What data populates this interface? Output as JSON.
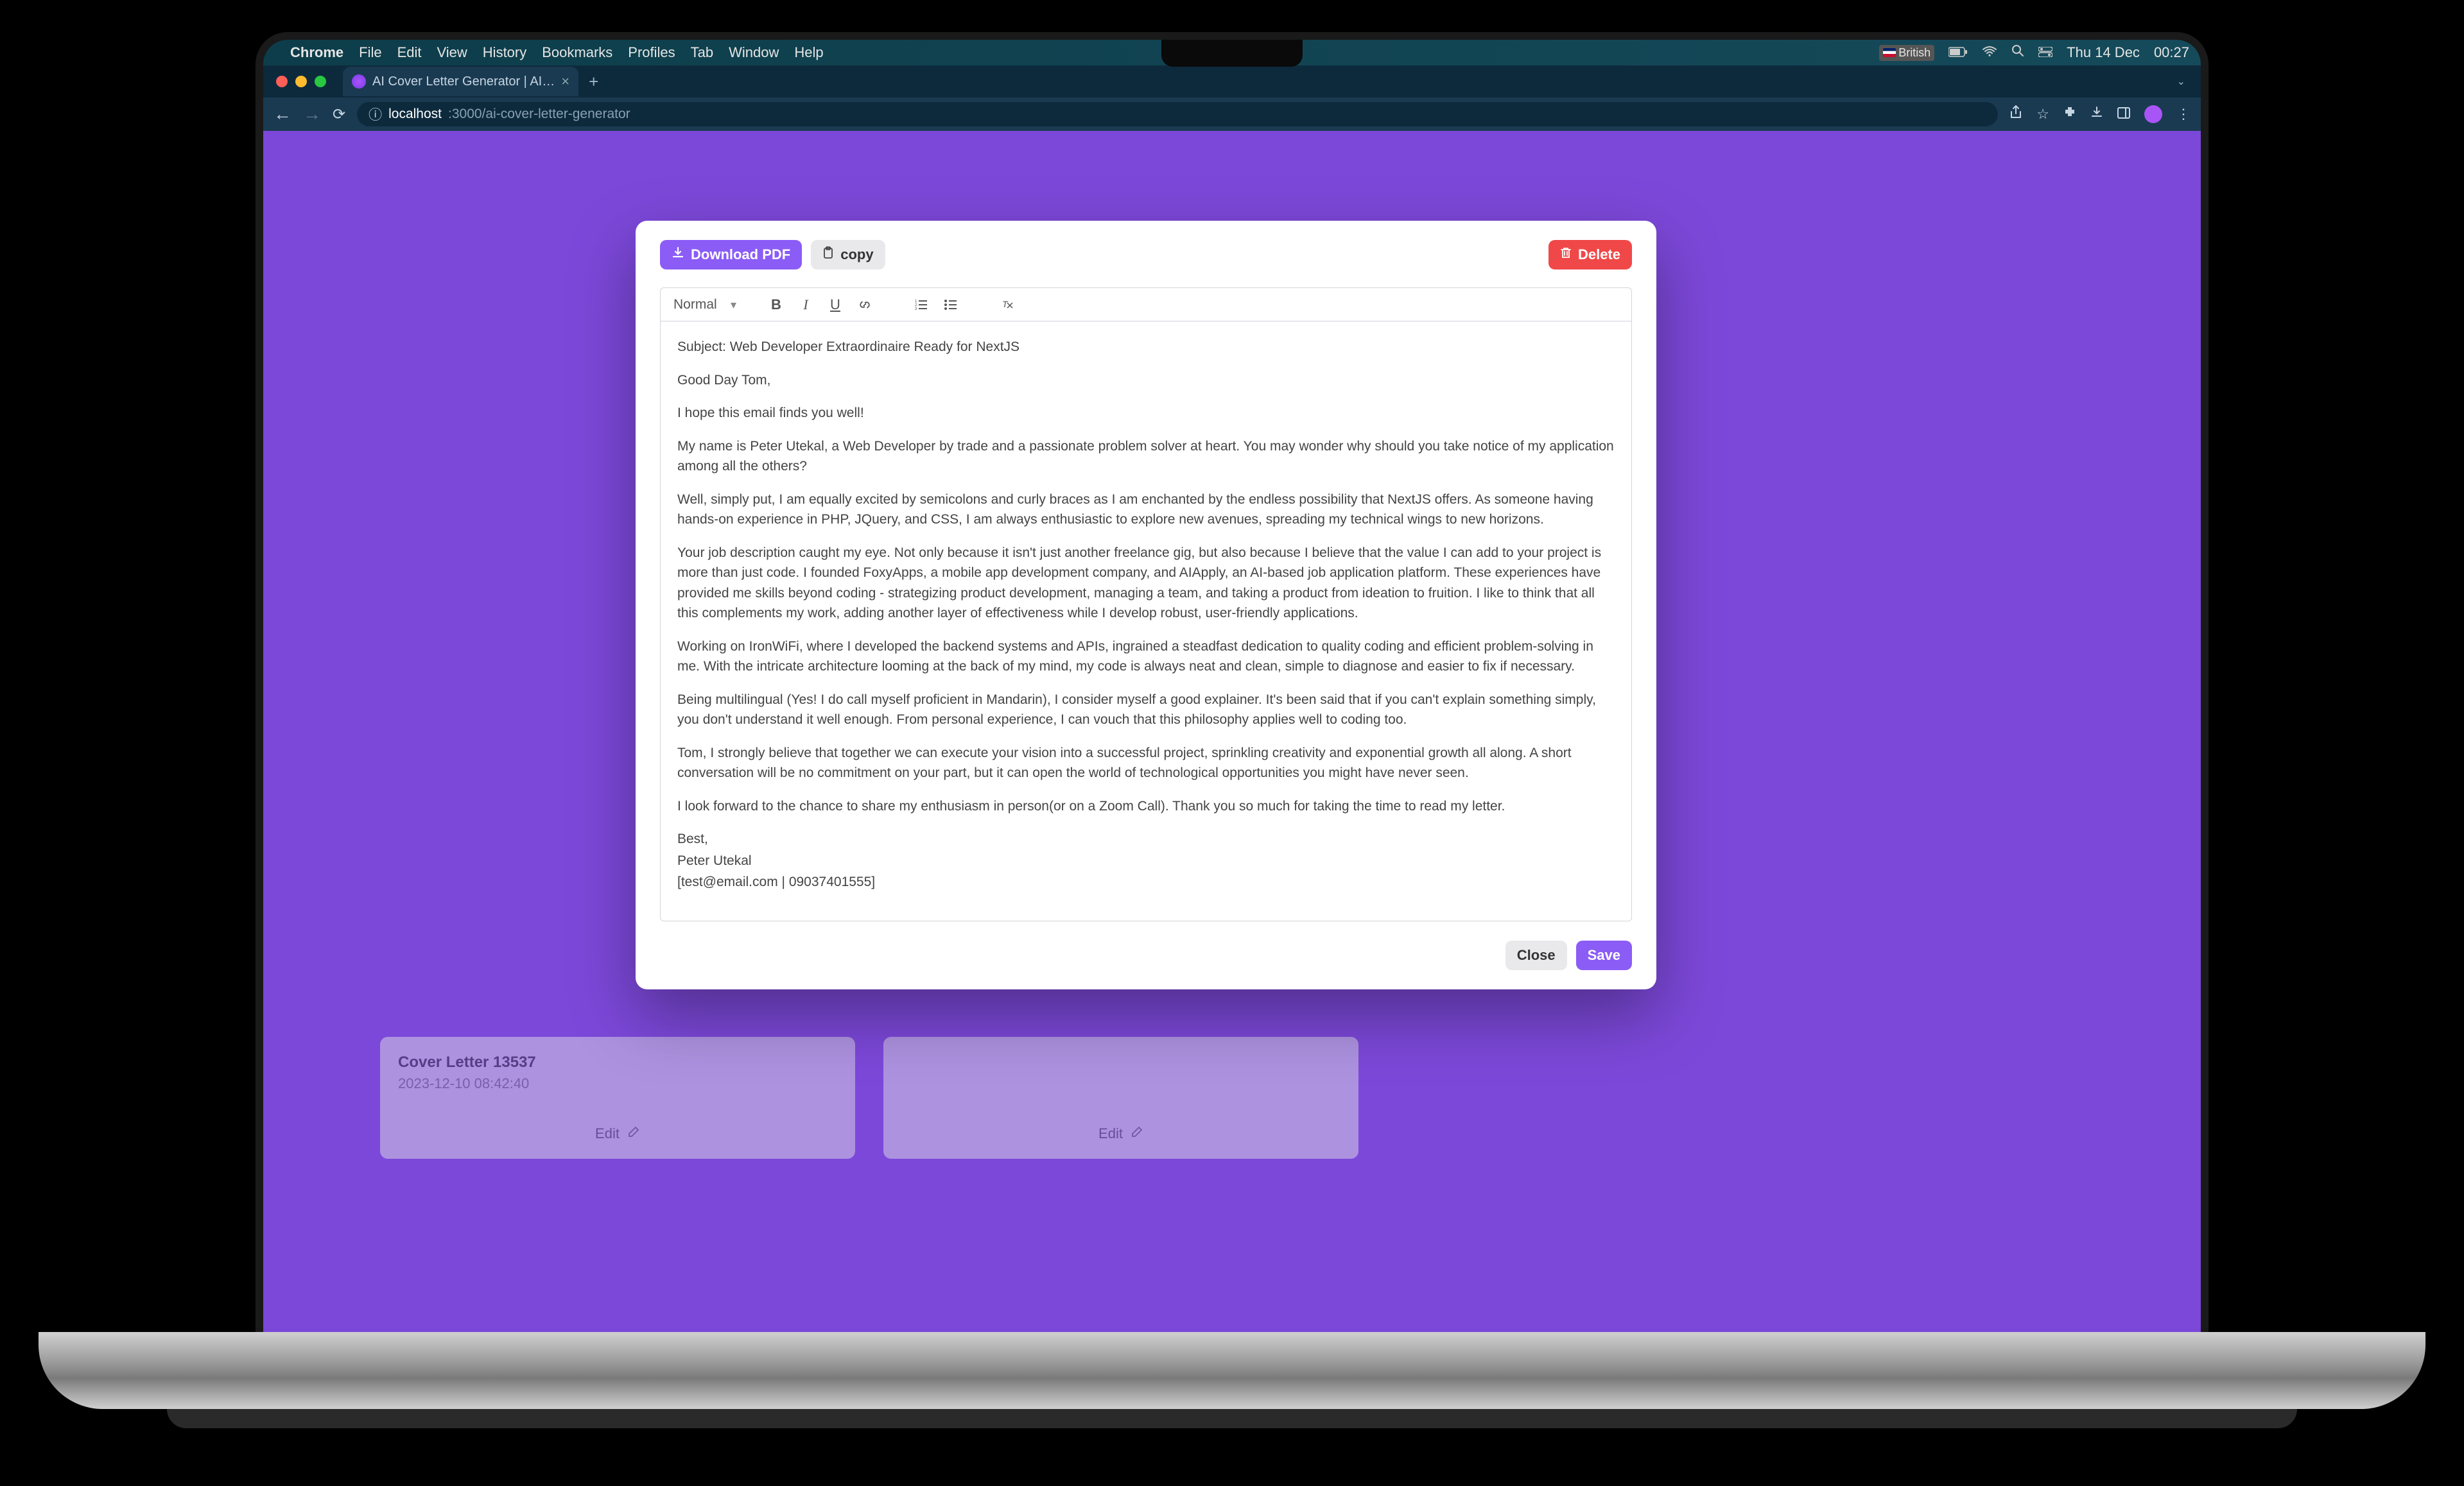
{
  "mac_menu": {
    "app": "Chrome",
    "items": [
      "File",
      "Edit",
      "View",
      "History",
      "Bookmarks",
      "Profiles",
      "Tab",
      "Window",
      "Help"
    ],
    "lang": "British",
    "date": "Thu 14 Dec",
    "time": "00:27"
  },
  "browser": {
    "tab_title": "AI Cover Letter Generator | AI…",
    "url_host": "localhost",
    "url_port_path": ":3000/ai-cover-letter-generator"
  },
  "bg_cards": {
    "c1": {
      "title": "Cover Letter 13537",
      "date": "2023-12-10 08:42:40",
      "edit": "Edit"
    },
    "c2": {
      "edit": "Edit"
    }
  },
  "modal": {
    "buttons": {
      "download": "Download PDF",
      "copy": "copy",
      "delete": "Delete",
      "close": "Close",
      "save": "Save"
    },
    "format_select": "Normal",
    "letter": {
      "subject": "Subject: Web Developer Extraordinaire Ready for NextJS",
      "greeting": "Good Day Tom,",
      "p1": "I hope this email finds you well!",
      "p2": "My name is Peter Utekal, a Web Developer by trade and a passionate problem solver at heart. You may wonder why should you take notice of my application among all the others?",
      "p3": "Well, simply put, I am equally excited by semicolons and curly braces as I am enchanted by the endless possibility that NextJS offers. As someone having hands-on experience in PHP, JQuery, and CSS, I am always enthusiastic to explore new avenues, spreading my technical wings to new horizons.",
      "p4": "Your job description caught my eye. Not only because it isn't just another freelance gig, but also because I believe that the value I can add to your project is more than just code. I founded FoxyApps, a mobile app development company, and AIApply, an AI-based job application platform. These experiences have provided me skills beyond coding - strategizing product development, managing a team, and taking a product from ideation to fruition. I like to think that all this complements my work, adding another layer of effectiveness while I develop robust, user-friendly applications.",
      "p5": "Working on IronWiFi, where I developed the backend systems and APIs, ingrained a steadfast dedication to quality coding and efficient problem-solving in me. With the intricate architecture looming at the back of my mind, my code is always neat and clean, simple to diagnose and easier to fix if necessary.",
      "p6": "Being multilingual (Yes! I do call myself proficient in Mandarin), I consider myself a good explainer. It's been said that if you can't explain something simply, you don't understand it well enough. From personal experience, I can vouch that this philosophy applies well to coding too.",
      "p7": "Tom, I strongly believe that together we can execute your vision into a successful project, sprinkling creativity and exponential growth all along. A short conversation will be no commitment on your part, but it can open the world of technological opportunities you might have never seen.",
      "p8": "I look forward to the chance to share my enthusiasm in person(or on a Zoom Call). Thank you so much for taking the time to read my letter.",
      "closing": "Best,",
      "name": "Peter Utekal",
      "contact": "[test@email.com | 09037401555]"
    }
  }
}
